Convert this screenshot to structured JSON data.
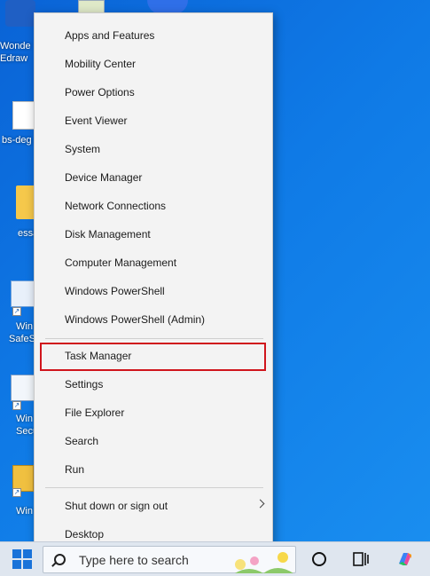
{
  "desktop": {
    "icons": [
      {
        "label": "Wonde\nEdraw",
        "line1": "Wonde",
        "line2": "Edraw"
      },
      {
        "label": "bs-deg",
        "line1": "bs-deg",
        "line2": ""
      },
      {
        "label": "essa",
        "line1": "essa",
        "line2": ""
      },
      {
        "label": "Win SafeS",
        "line1": "Win",
        "line2": "SafeS"
      },
      {
        "label": "Win Secu",
        "line1": "Win",
        "line2": "Secu"
      },
      {
        "label": "Win",
        "line1": "Win",
        "line2": ""
      }
    ]
  },
  "menu": {
    "items": [
      {
        "label": "Apps and Features"
      },
      {
        "label": "Mobility Center"
      },
      {
        "label": "Power Options"
      },
      {
        "label": "Event Viewer"
      },
      {
        "label": "System"
      },
      {
        "label": "Device Manager"
      },
      {
        "label": "Network Connections"
      },
      {
        "label": "Disk Management"
      },
      {
        "label": "Computer Management"
      },
      {
        "label": "Windows PowerShell"
      },
      {
        "label": "Windows PowerShell (Admin)"
      },
      {
        "label": "Task Manager"
      },
      {
        "label": "Settings"
      },
      {
        "label": "File Explorer"
      },
      {
        "label": "Search"
      },
      {
        "label": "Run"
      },
      {
        "label": "Shut down or sign out"
      },
      {
        "label": "Desktop"
      }
    ],
    "highlighted_item": "Task Manager",
    "highlight_color": "#d0151c"
  },
  "taskbar": {
    "search_placeholder": "Type here to search",
    "start_icon": "windows-logo-icon",
    "cortana_icon": "circle-icon",
    "taskview_icon": "task-view-icon",
    "copilot_icon": "copilot-icon"
  }
}
